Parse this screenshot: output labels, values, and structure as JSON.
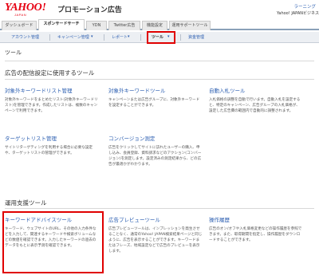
{
  "header": {
    "logo": "YAHOO!",
    "logo_sub": "JAPAN",
    "product": "プロモーション広告",
    "help": "ラーニング",
    "account": "Yahoo! JAPANビジネス"
  },
  "tabs": [
    {
      "label": "ダッシュボード"
    },
    {
      "label": "スポンサードサーチ"
    },
    {
      "label": "YDN"
    },
    {
      "label": "Twitter広告"
    },
    {
      "label": "機能設定"
    },
    {
      "label": "運用サポートツール"
    }
  ],
  "subnav": {
    "account_settings": "アカウント管理",
    "campaign_management": "キャンペーン管理",
    "reports": "レポート",
    "tools": "ツール",
    "budget": "資金管理"
  },
  "page": {
    "heading": "ツール",
    "section1": "広告の配信設定に使用するツール",
    "section2": "運用支援ツール"
  },
  "tools": {
    "target_keyword_list": {
      "title": "対象外キーワードリスト管理",
      "desc": "対象外キーワードをまとめたリスト(対象外キーワードリスト)を管理できます。作成したリストは、複数のキャンペーンで利用できます。"
    },
    "target_keyword": {
      "title": "対象外キーワードツール",
      "desc": "キャンペーンまたは広告グループに、対象外キーワードを設定することができます。"
    },
    "auto_bid": {
      "title": "自動入札ツール",
      "desc": "入札価格の調整を自動で行います。自動入札を設定すると、特定のキャンペーン、広告グループの入札価格が、設定した広告費の範囲内で自動的に調整されます。"
    },
    "target_list": {
      "title": "ターゲットリスト管理",
      "desc": "サイトリターゲティングを利用する場合に必要な設定や、ターゲットリストの管理ができます。"
    },
    "conversion": {
      "title": "コンバージョン測定",
      "desc": "広告をクリックしてサイトに訪れたユーザーの購入、申し込み、会員登録、資料請求などのアクション(コンバージョン)を測定します。設定済みの測定結果から、どの広告が最適かがわかります。"
    },
    "keyword_advice": {
      "title": "キーワードアドバイスツール",
      "desc": "キーワード、ウェブサイトのURL、その他の入力条件などを入力して、関連するキーワードや検索ボリュームなどの数値を確認できます。入力したキーワードの過去のデータをもとに表示予測を確認できます。"
    },
    "ad_preview": {
      "title": "広告プレビューツール",
      "desc": "広告プレビューツールは、インプレッションを発生させることなく、通常のYahoo! JAPAN検索結果ページと同じように、広告を表示することができます。キーワードまたはフレーズ、地域設定などで広告のプレビューを表示します。"
    },
    "operation_history": {
      "title": "操作履歴",
      "desc": "広告のオン/オフや入札価格変更などの操作履歴を参照できます。また、取得期間を指定し、操作履歴をダウンロードすることができます。"
    }
  },
  "colors": {
    "brand": "#e60012",
    "link": "#2a5db0",
    "highlight": "#e00000"
  }
}
